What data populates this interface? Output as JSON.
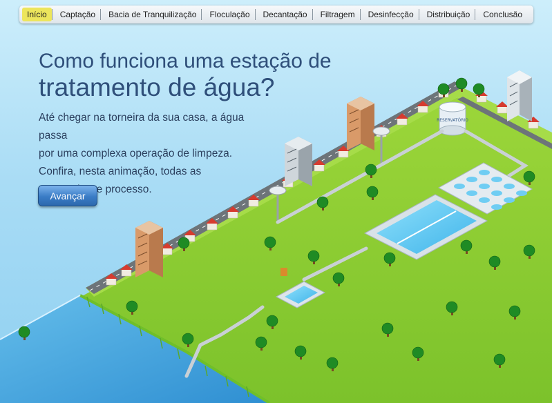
{
  "nav": {
    "items": [
      {
        "label": "Início",
        "active": true
      },
      {
        "label": "Captação",
        "active": false
      },
      {
        "label": "Bacia de Tranquilização",
        "active": false
      },
      {
        "label": "Floculação",
        "active": false
      },
      {
        "label": "Decantação",
        "active": false
      },
      {
        "label": "Filtragem",
        "active": false
      },
      {
        "label": "Desinfecção",
        "active": false
      },
      {
        "label": "Distribuição",
        "active": false
      },
      {
        "label": "Conclusão",
        "active": false
      }
    ]
  },
  "headline": {
    "line1": "Como funciona uma estação de",
    "line2": "tratamento de água?"
  },
  "intro": {
    "line1": "Até chegar na torneira da sua casa, a água passa",
    "line2": "por uma complexa operação de limpeza.",
    "line3": "Confira, nesta animação, todas as",
    "line4": "etapas desse processo."
  },
  "next_button": {
    "label": "Avançar"
  },
  "reservoir_label": "RESERVATÓRIO",
  "colors": {
    "sky": "#a9dcf5",
    "grass": "#8bcf2f",
    "river": "#4aa8e0",
    "road": "#6d7479",
    "headline": "#2f4f7a",
    "active_tab": "#ece55c"
  }
}
